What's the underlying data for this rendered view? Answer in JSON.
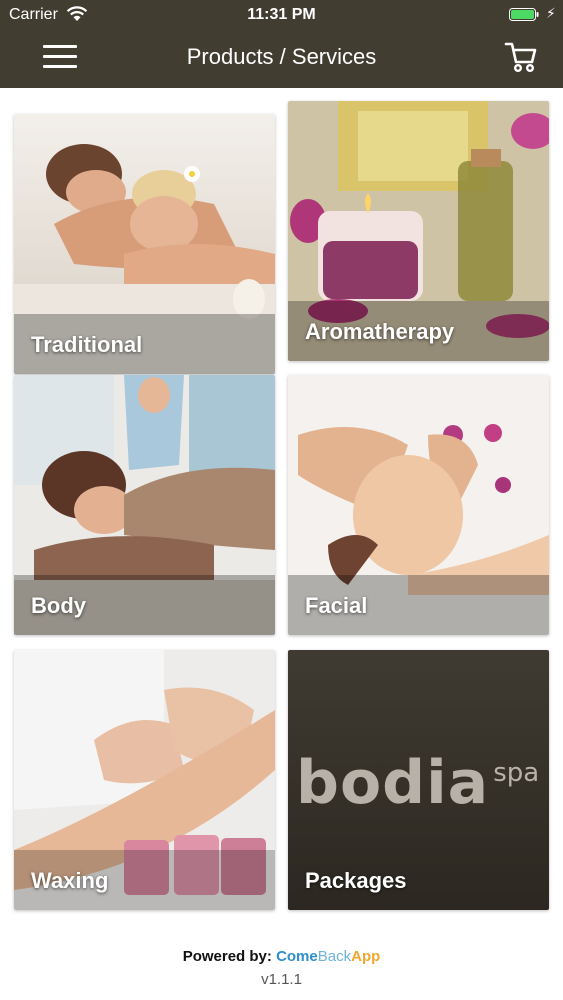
{
  "status_bar": {
    "carrier": "Carrier",
    "time": "11:31 PM",
    "battery_color": "#4cd964"
  },
  "nav": {
    "title": "Products / Services",
    "menu_icon": "hamburger-menu-icon",
    "cart_icon": "shopping-cart-icon",
    "background": "#423d31"
  },
  "tiles": [
    {
      "label": "Traditional"
    },
    {
      "label": "Aromatherapy"
    },
    {
      "label": "Body"
    },
    {
      "label": "Facial"
    },
    {
      "label": "Waxing"
    },
    {
      "label": "Packages",
      "logo_text": "bodia",
      "logo_sub": "spa"
    }
  ],
  "footer": {
    "powered_label": "Powered by:",
    "brand_part1": "Come",
    "brand_part2": "Back",
    "brand_part3": "App",
    "version": "v1.1.1"
  }
}
